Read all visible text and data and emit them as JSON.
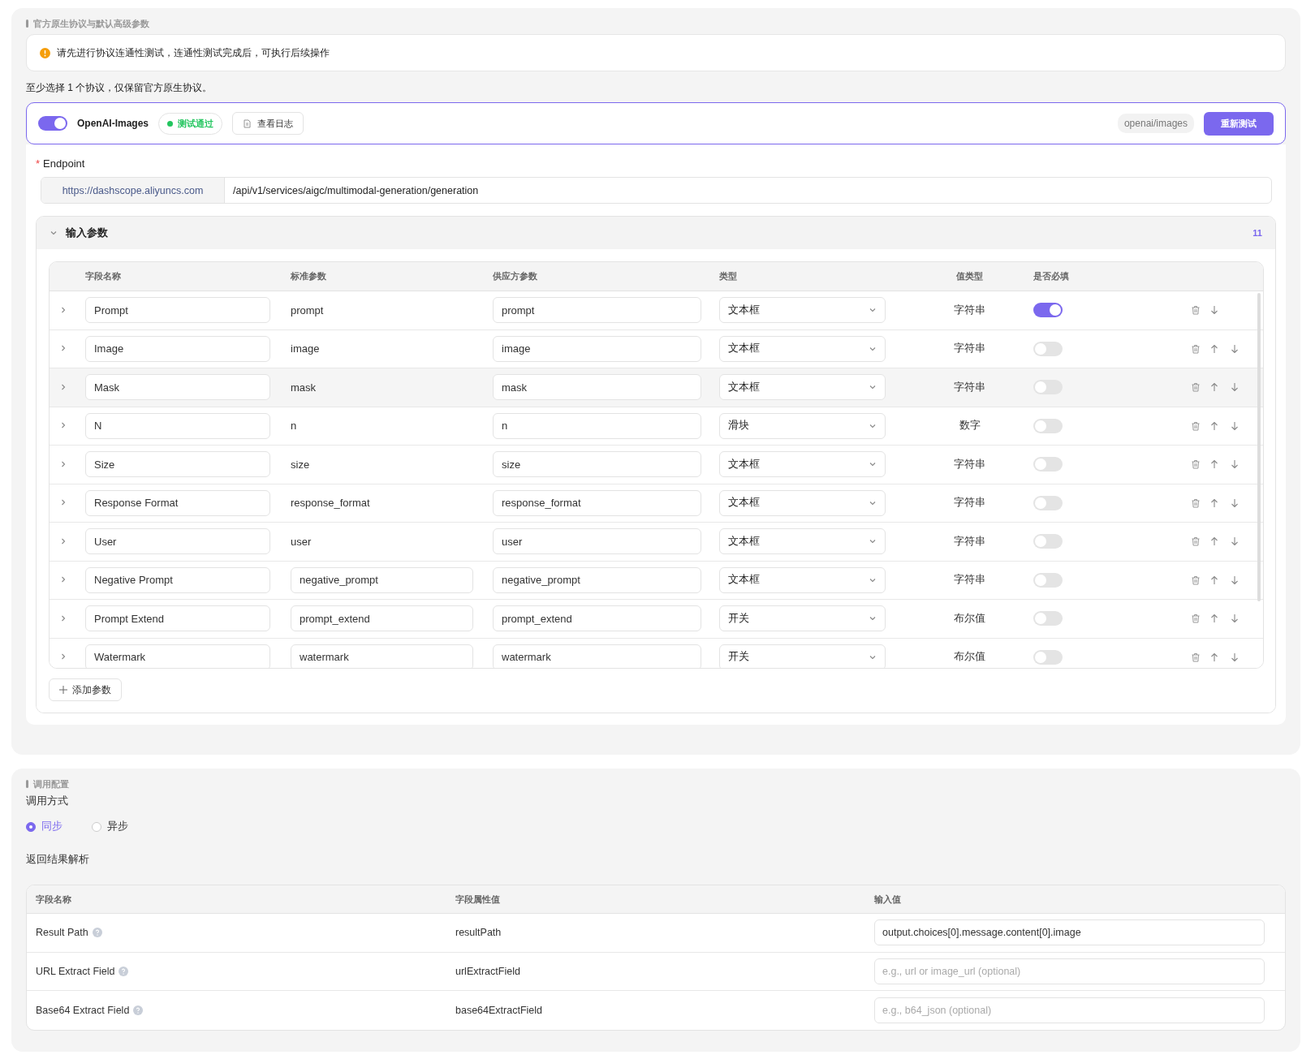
{
  "protocol_section": {
    "title": "官方原生协议与默认高级参数",
    "alert": "请先进行协议连通性测试，连通性测试完成后，可执行后续操作",
    "hint": "至少选择 1 个协议，仅保留官方原生协议。",
    "protocol": {
      "enabled": true,
      "name": "OpenAI-Images",
      "status": "测试通过",
      "log_button": "查看日志",
      "tag": "openai/images",
      "retest_button": "重新测试"
    },
    "endpoint": {
      "label": "Endpoint",
      "required_mark": "*",
      "base": "https://dashscope.aliyuncs.com",
      "path": "/api/v1/services/aigc/multimodal-generation/generation"
    },
    "input_params": {
      "title": "输入参数",
      "expanded": true,
      "count": "11",
      "columns": [
        "字段名称",
        "标准参数",
        "供应方参数",
        "类型",
        "值类型",
        "是否必填"
      ],
      "rows": [
        {
          "name": "Prompt",
          "standard": "prompt",
          "standard_editable": false,
          "supplier": "prompt",
          "type": "文本框",
          "value_type": "字符串",
          "required": true,
          "highlighted": false,
          "can_move_up": false
        },
        {
          "name": "Image",
          "standard": "image",
          "standard_editable": false,
          "supplier": "image",
          "type": "文本框",
          "value_type": "字符串",
          "required": false,
          "highlighted": false,
          "can_move_up": true
        },
        {
          "name": "Mask",
          "standard": "mask",
          "standard_editable": false,
          "supplier": "mask",
          "type": "文本框",
          "value_type": "字符串",
          "required": false,
          "highlighted": true,
          "can_move_up": true
        },
        {
          "name": "N",
          "standard": "n",
          "standard_editable": false,
          "supplier": "n",
          "type": "滑块",
          "value_type": "数字",
          "required": false,
          "highlighted": false,
          "can_move_up": true
        },
        {
          "name": "Size",
          "standard": "size",
          "standard_editable": false,
          "supplier": "size",
          "type": "文本框",
          "value_type": "字符串",
          "required": false,
          "highlighted": false,
          "can_move_up": true
        },
        {
          "name": "Response Format",
          "standard": "response_format",
          "standard_editable": false,
          "supplier": "response_format",
          "type": "文本框",
          "value_type": "字符串",
          "required": false,
          "highlighted": false,
          "can_move_up": true
        },
        {
          "name": "User",
          "standard": "user",
          "standard_editable": false,
          "supplier": "user",
          "type": "文本框",
          "value_type": "字符串",
          "required": false,
          "highlighted": false,
          "can_move_up": true
        },
        {
          "name": "Negative Prompt",
          "standard": "negative_prompt",
          "standard_editable": true,
          "supplier": "negative_prompt",
          "type": "文本框",
          "value_type": "字符串",
          "required": false,
          "highlighted": false,
          "can_move_up": true
        },
        {
          "name": "Prompt Extend",
          "standard": "prompt_extend",
          "standard_editable": true,
          "supplier": "prompt_extend",
          "type": "开关",
          "value_type": "布尔值",
          "required": false,
          "highlighted": false,
          "can_move_up": true
        },
        {
          "name": "Watermark",
          "standard": "watermark",
          "standard_editable": true,
          "supplier": "watermark",
          "type": "开关",
          "value_type": "布尔值",
          "required": false,
          "highlighted": false,
          "can_move_up": true
        }
      ],
      "add_button": "添加参数"
    }
  },
  "call_section": {
    "title": "调用配置",
    "mode_label": "调用方式",
    "modes": [
      {
        "label": "同步",
        "selected": true
      },
      {
        "label": "异步",
        "selected": false
      }
    ],
    "result_label": "返回结果解析",
    "columns": [
      "字段名称",
      "字段属性值",
      "输入值"
    ],
    "rows": [
      {
        "name": "Result Path",
        "attribute": "resultPath",
        "value": "output.choices[0].message.content[0].image"
      },
      {
        "name": "URL Extract Field",
        "attribute": "urlExtractField",
        "placeholder": "e.g., url or image_url (optional)"
      },
      {
        "name": "Base64 Extract Field",
        "attribute": "base64ExtractField",
        "placeholder": "e.g., b64_json (optional)"
      }
    ]
  }
}
